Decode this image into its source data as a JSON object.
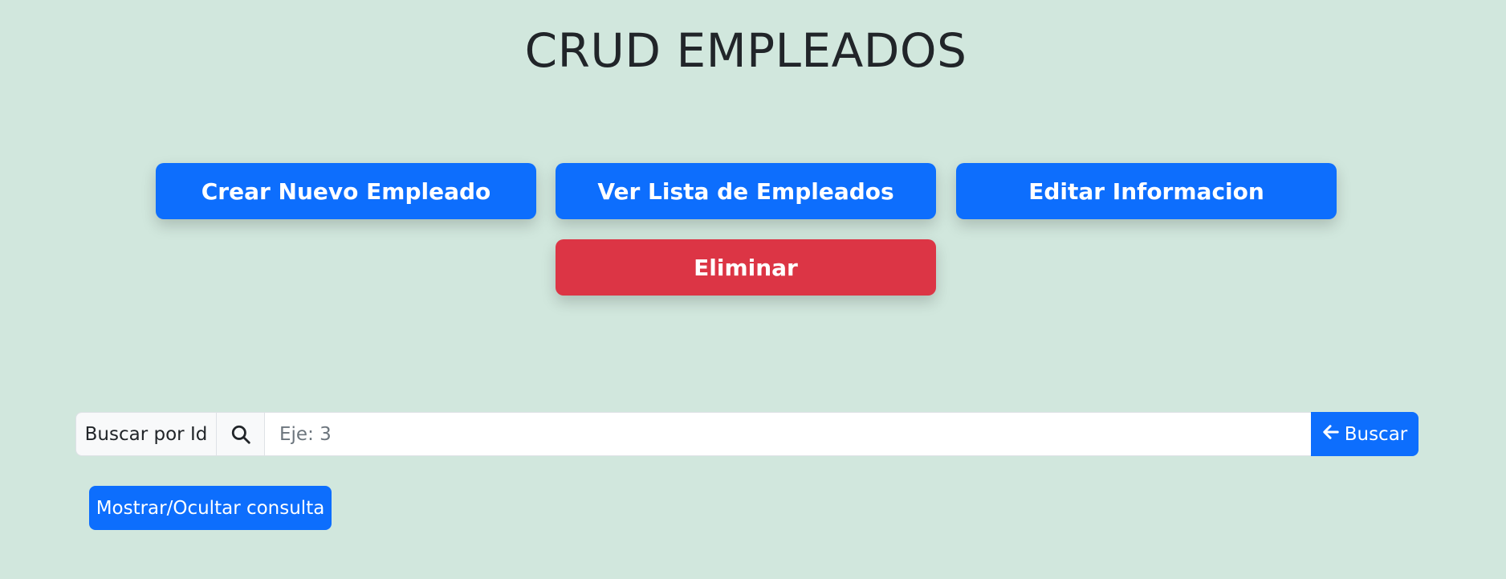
{
  "page": {
    "title": "CRUD EMPLEADOS",
    "background_color": "#d1e7dd"
  },
  "actions": {
    "create_label": "Crear Nuevo Empleado",
    "list_label": "Ver Lista de Empleados",
    "edit_label": "Editar Informacion",
    "delete_label": "Eliminar",
    "primary_color": "#0d6efd",
    "danger_color": "#dc3545"
  },
  "search": {
    "label": "Buscar por Id",
    "icon": "search-icon",
    "placeholder": "Eje: 3",
    "value": "",
    "button_icon": "arrow-left-icon",
    "button_label": "Buscar"
  },
  "toggle": {
    "label": "Mostrar/Ocultar consulta"
  }
}
